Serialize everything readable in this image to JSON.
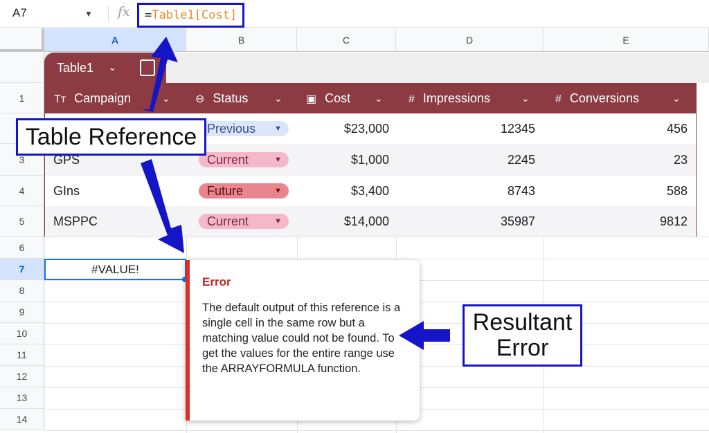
{
  "formula_bar": {
    "name_box": "A7",
    "name_caret": "▼",
    "fx_icon": "fx",
    "formula_eq": "=",
    "formula_ref": "Table1[Cost]"
  },
  "columns": [
    "A",
    "B",
    "C",
    "D",
    "E"
  ],
  "active_column": "A",
  "rows": [
    "1",
    "3",
    "4",
    "5",
    "6",
    "7",
    "8",
    "9",
    "10",
    "11",
    "12",
    "13",
    "14"
  ],
  "active_row": "7",
  "table": {
    "name": "Table1",
    "caret": "⌄",
    "headers": [
      {
        "icon": "Tт",
        "label": "Campaign"
      },
      {
        "icon": "⊖",
        "label": "Status"
      },
      {
        "icon": "▣",
        "label": "Cost"
      },
      {
        "icon": "#",
        "label": "Impressions"
      },
      {
        "icon": "#",
        "label": "Conversions"
      }
    ],
    "chevron": "⌄",
    "rows": [
      {
        "campaign": "",
        "status": "Previous",
        "cost": "$23,000",
        "impressions": "12345",
        "conversions": "456"
      },
      {
        "campaign": "GPS",
        "status": "Current",
        "cost": "$1,000",
        "impressions": "2245",
        "conversions": "23"
      },
      {
        "campaign": "GIns",
        "status": "Future",
        "cost": "$3,400",
        "impressions": "8743",
        "conversions": "588"
      },
      {
        "campaign": "MSPPC",
        "status": "Current",
        "cost": "$14,000",
        "impressions": "35987",
        "conversions": "9812"
      }
    ],
    "chip_arrow": "▼"
  },
  "selected_cell": {
    "value": "#VALUE!"
  },
  "error_popup": {
    "title": "Error",
    "message": "The default output of this reference is a single cell in the same row but a matching value could not be found. To get the values for the entire range use the ARRAYFORMULA function."
  },
  "callouts": {
    "table_reference": "Table Reference",
    "resultant_error_line1": "Resultant",
    "resultant_error_line2": "Error"
  },
  "colors": {
    "table_header": "#8c3b43",
    "callout_blue": "#1414c8",
    "error_red": "#d93025",
    "selection_blue": "#1a73e8"
  }
}
